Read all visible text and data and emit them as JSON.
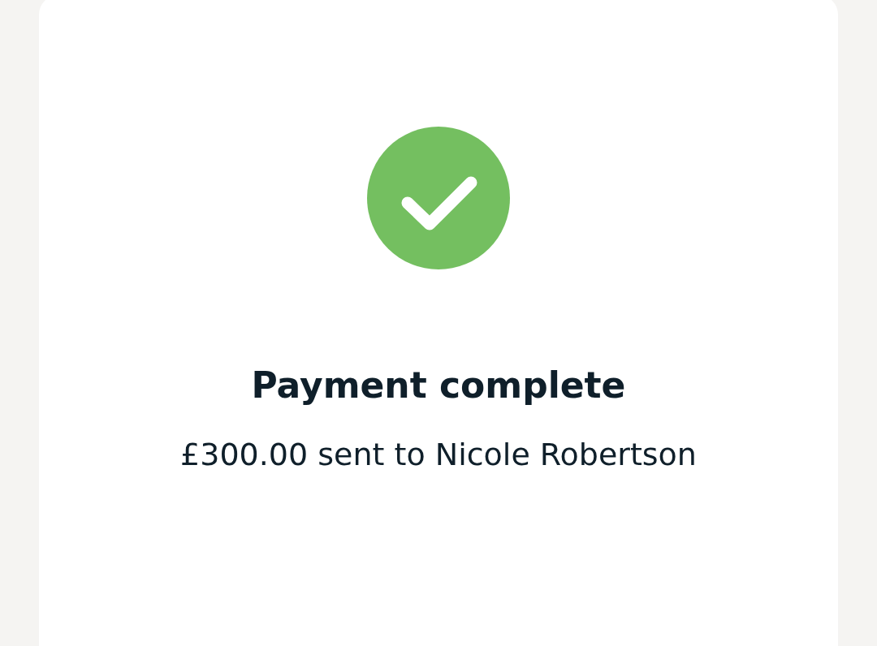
{
  "status": {
    "kind": "success"
  },
  "title": "Payment complete",
  "message": "£300.00 sent to Nicole Robertson"
}
